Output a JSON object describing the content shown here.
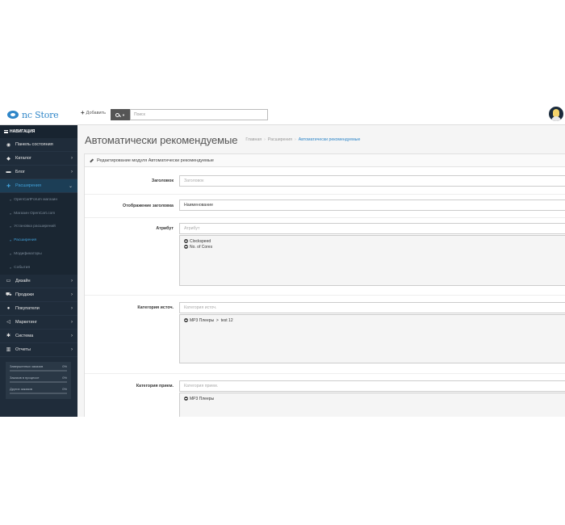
{
  "header": {
    "logo_text": "nc Store",
    "add_label": "Добавить",
    "search_placeholder": "Поиск"
  },
  "sidebar": {
    "nav_title": "НАВИГАЦИЯ",
    "items": [
      {
        "label": "Панель состояния",
        "icon": "dashboard-icon"
      },
      {
        "label": "Каталог",
        "icon": "tag-icon"
      },
      {
        "label": "Блог",
        "icon": "book-icon"
      },
      {
        "label": "Расширения",
        "icon": "puzzle-icon",
        "active": true
      }
    ],
    "sub_items": [
      {
        "label": "OpenCartForum магазин"
      },
      {
        "label": "Магазин OpenCart.com"
      },
      {
        "label": "Установка расширений"
      },
      {
        "label": "Расширения",
        "current": true
      },
      {
        "label": "Модификаторы"
      },
      {
        "label": "События"
      }
    ],
    "items_after": [
      {
        "label": "Дизайн",
        "icon": "monitor-icon"
      },
      {
        "label": "Продажи",
        "icon": "cart-icon"
      },
      {
        "label": "Покупатели",
        "icon": "user-icon"
      },
      {
        "label": "Маркетинг",
        "icon": "share-icon"
      },
      {
        "label": "Система",
        "icon": "gear-icon"
      },
      {
        "label": "Отчеты",
        "icon": "bar-chart-icon"
      }
    ],
    "progress": [
      {
        "label": "Завершенных заказов",
        "value": "0%",
        "fraction": 0
      },
      {
        "label": "Заказов в процессе",
        "value": "0%",
        "fraction": 0
      },
      {
        "label": "Других заказов",
        "value": "0%",
        "fraction": 0
      }
    ]
  },
  "main": {
    "title": "Автоматически рекомендуемые",
    "breadcrumb": [
      "Главная",
      "Расширения",
      "Автоматически рекомендуемые"
    ],
    "panel_title": "Редактирование модуля Автоматически рекомендуемые",
    "fields": {
      "heading": {
        "label": "Заголовок",
        "placeholder": "Заголовок"
      },
      "heading_display": {
        "label": "Отображение заголовка",
        "value": "Наименование"
      },
      "attribute": {
        "label": "Атрибут",
        "placeholder": "Атрибут",
        "items": [
          "Clockspeed",
          "No. of Cores"
        ]
      },
      "category_source": {
        "label": "Категория источ.",
        "placeholder": "Категория источ.",
        "items": [
          "MP3 Плееры  >  test 12"
        ]
      },
      "category_target": {
        "label": "Категория прием.",
        "placeholder": "Категория прием.",
        "items": [
          "MP3 Плееры"
        ]
      }
    }
  },
  "colors": {
    "sidebar_bg": "#1f2c3a",
    "accent": "#41a0d8",
    "brand": "#2f86c8"
  }
}
